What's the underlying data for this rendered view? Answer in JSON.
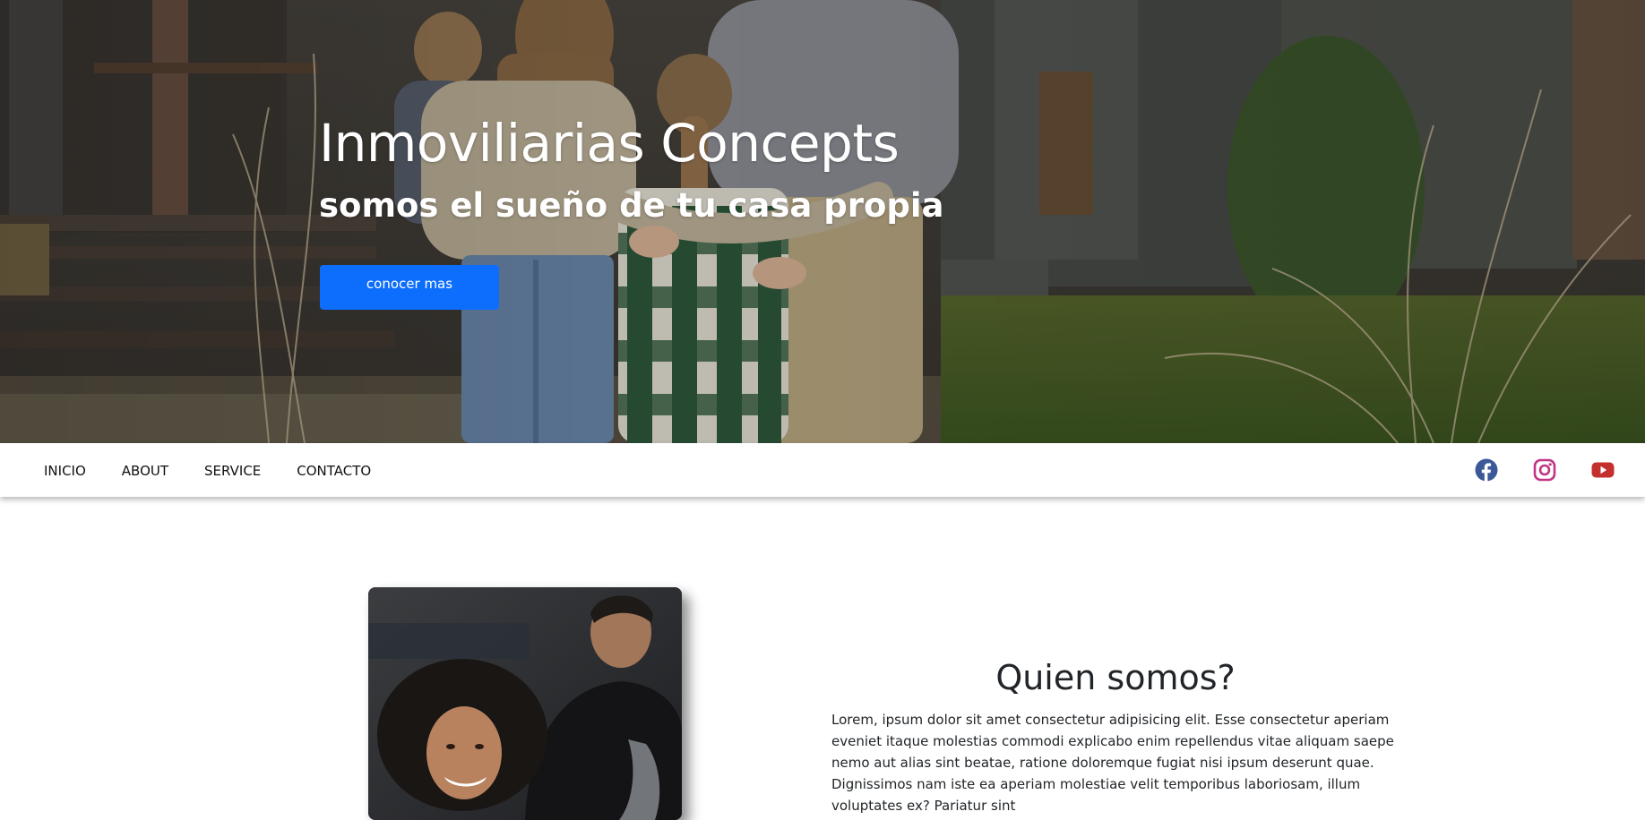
{
  "hero": {
    "title": "Inmoviliarias Concepts",
    "subtitle": "somos el sueño de tu casa propia",
    "button_label": "conocer mas",
    "button_color": "#0d6efd"
  },
  "nav": {
    "items": [
      {
        "label": "INICIO"
      },
      {
        "label": "ABOUT"
      },
      {
        "label": "SERVICE"
      },
      {
        "label": "CONTACTO"
      }
    ],
    "social": [
      {
        "icon": "facebook-icon",
        "color": "#3b5998"
      },
      {
        "icon": "instagram-icon",
        "color": "#c13584"
      },
      {
        "icon": "youtube-icon",
        "color": "#c4302b"
      }
    ]
  },
  "about": {
    "heading": "Quien somos?",
    "text": "Lorem, ipsum dolor sit amet consectetur adipisicing elit. Esse consectetur aperiam eveniet itaque molestias commodi explicabo enim repellendus vitae aliquam saepe nemo aut alias sint beatae, ratione doloremque fugiat nisi ipsum deserunt quae. Dignissimos nam iste ea aperiam molestiae velit temporibus laboriosam, illum voluptates ex? Pariatur sint"
  }
}
